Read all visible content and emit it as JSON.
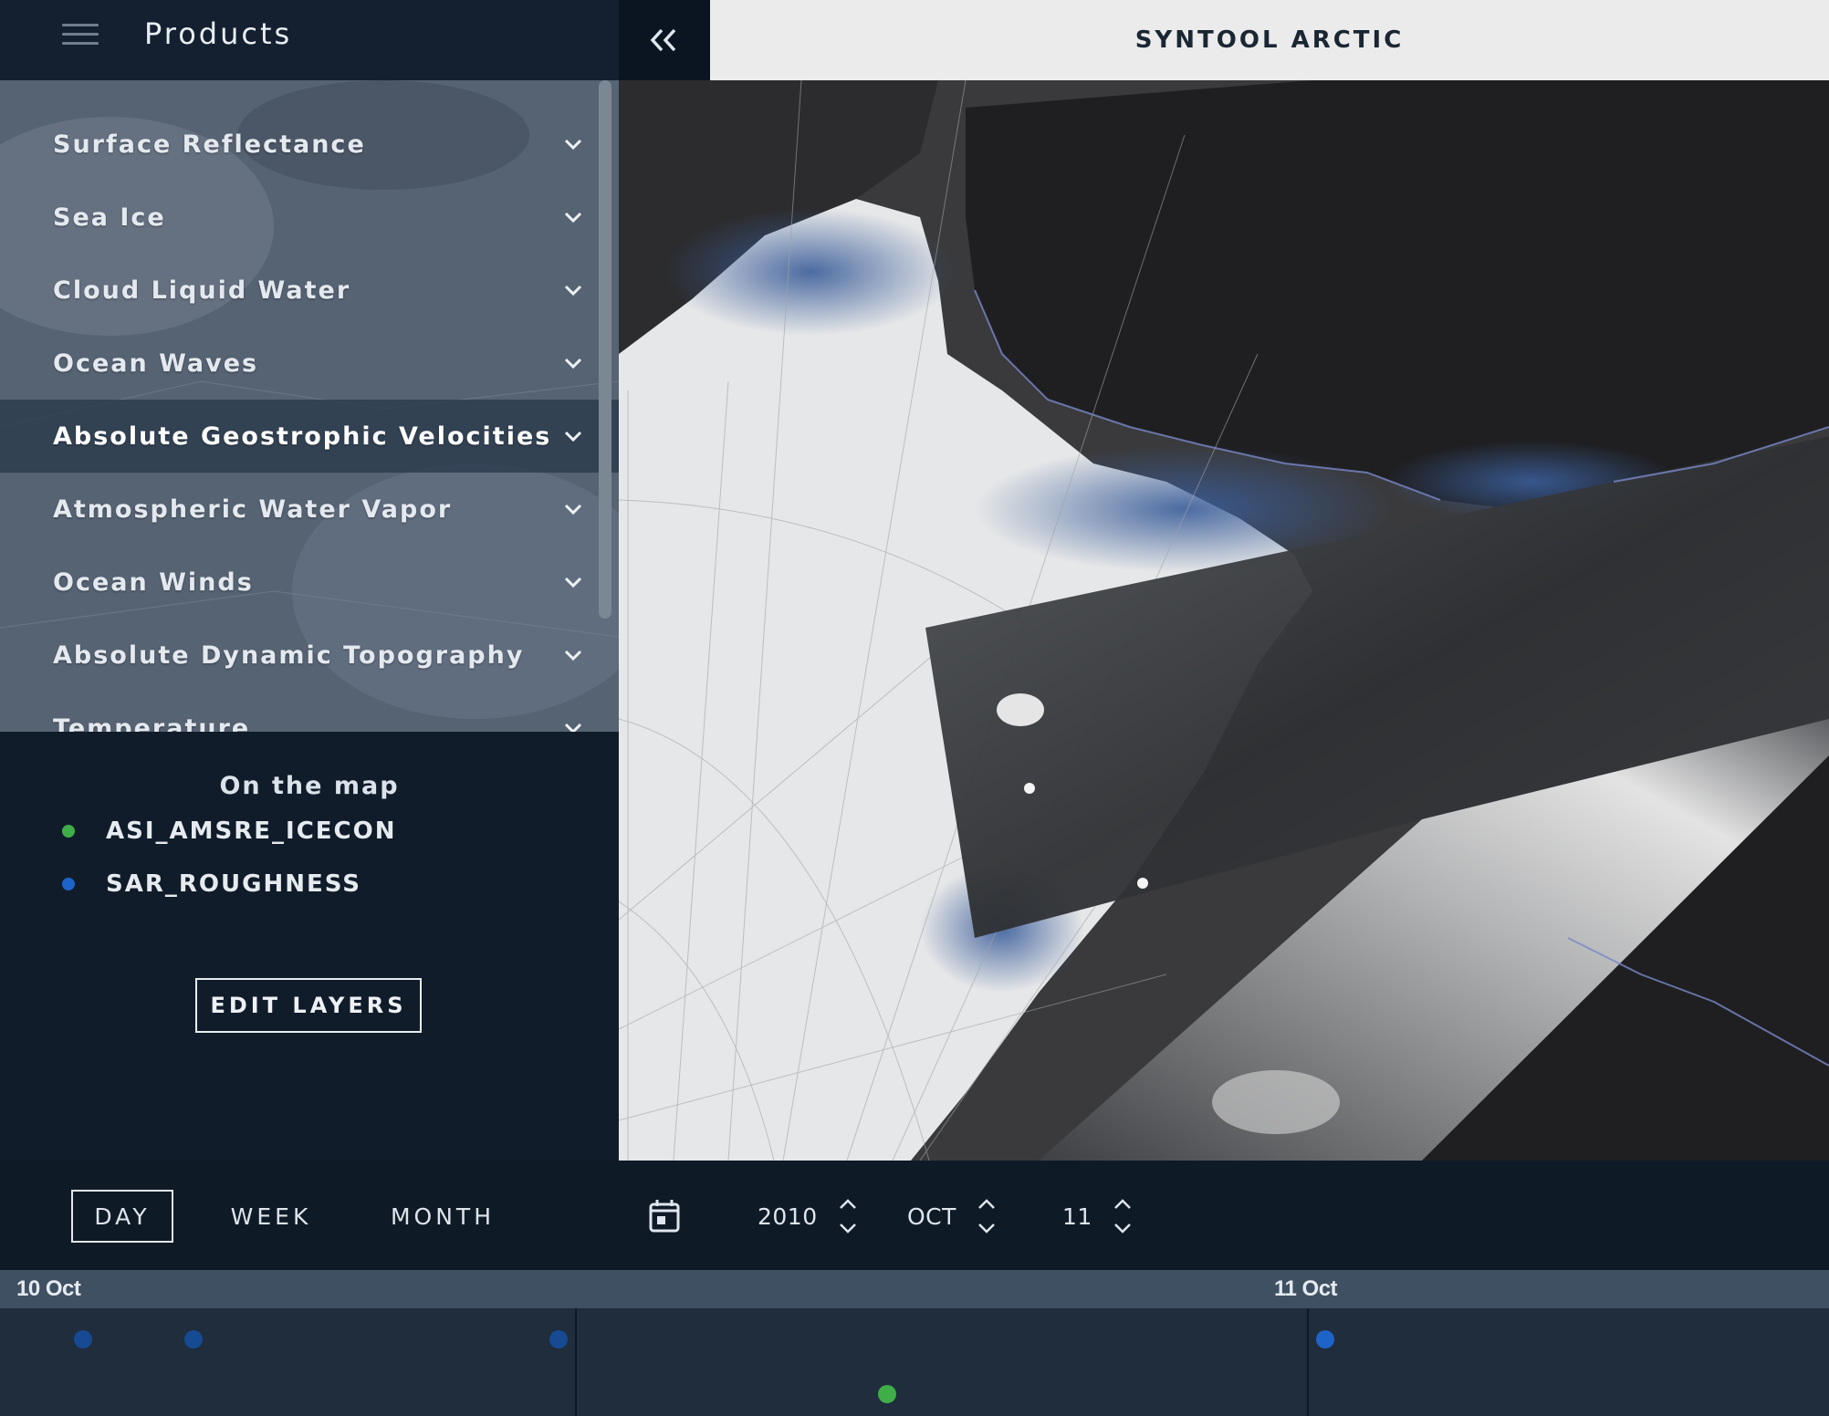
{
  "header": {
    "products_title": "Products",
    "app_title": "SYNTOOL ARCTIC"
  },
  "sidebar": {
    "products": [
      {
        "label": "Surface Reflectance",
        "active": false
      },
      {
        "label": "Sea Ice",
        "active": false
      },
      {
        "label": "Cloud Liquid Water",
        "active": false
      },
      {
        "label": "Ocean Waves",
        "active": false
      },
      {
        "label": "Absolute Geostrophic Velocities",
        "active": true
      },
      {
        "label": "Atmospheric Water Vapor",
        "active": false
      },
      {
        "label": "Ocean Winds",
        "active": false
      },
      {
        "label": "Absolute Dynamic Topography",
        "active": false
      },
      {
        "label": "Temperature",
        "active": false
      }
    ],
    "on_map": {
      "title": "On the map",
      "layers": [
        {
          "name": "ASI_AMSRE_ICECON",
          "color": "#3fae49"
        },
        {
          "name": "SAR_ROUGHNESS",
          "color": "#1e63c8"
        }
      ],
      "edit_label": "EDIT LAYERS"
    }
  },
  "controls": {
    "ranges": [
      "DAY",
      "WEEK",
      "MONTH"
    ],
    "selected_range": "DAY",
    "year": "2010",
    "month": "OCT",
    "day": "11"
  },
  "timeline": {
    "dates": [
      "10 Oct",
      "11 Oct"
    ],
    "colors": {
      "icecon": "#3fae49",
      "sar": "#1e63c8",
      "sar_faded": "#164a92"
    }
  },
  "icons": {
    "menu": "hamburger-icon",
    "collapse": "double-chevron-left-icon",
    "expand": "chevron-down-icon",
    "calendar": "calendar-icon",
    "increment": "chevron-up-icon",
    "decrement": "chevron-down-icon"
  }
}
